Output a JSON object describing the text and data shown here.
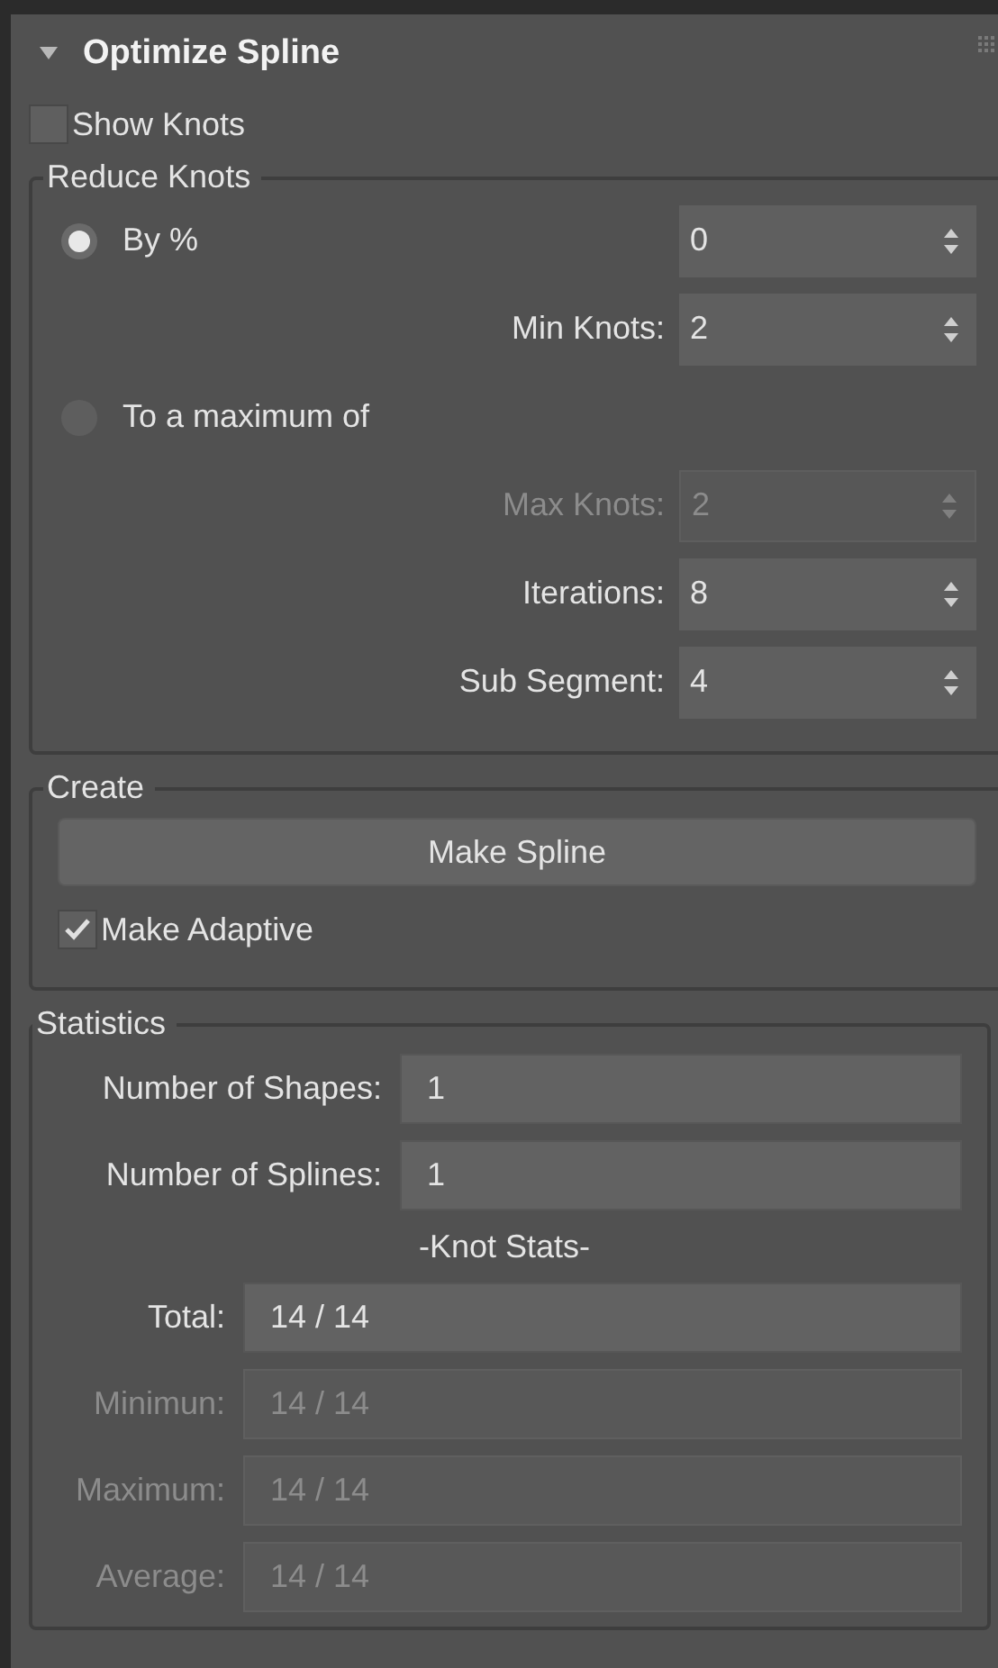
{
  "panel": {
    "title": "Optimize Spline",
    "expanded": true
  },
  "show_knots": {
    "label": "Show Knots",
    "checked": false
  },
  "reduce_knots": {
    "title": "Reduce Knots",
    "rows": [
      {
        "kind": "radio",
        "label": "By %",
        "selected": true,
        "value": "0"
      },
      {
        "kind": "spinner",
        "label": "Min Knots:",
        "value": "2",
        "disabled": false
      },
      {
        "kind": "radio",
        "label": "To a maximum of",
        "selected": false
      },
      {
        "kind": "spinner",
        "label": "Max Knots:",
        "value": "2",
        "disabled": true
      },
      {
        "kind": "spinner",
        "label": "Iterations:",
        "value": "8",
        "disabled": false
      },
      {
        "kind": "spinner",
        "label": "Sub Segment:",
        "value": "4",
        "disabled": false
      }
    ]
  },
  "create": {
    "title": "Create",
    "button": "Make Spline",
    "make_adaptive": {
      "label": "Make Adaptive",
      "checked": true
    }
  },
  "statistics": {
    "title": "Statistics",
    "rows": [
      {
        "label": "Number of Shapes:",
        "value": "1",
        "disabled": false
      },
      {
        "label": "Number of Splines:",
        "value": "1",
        "disabled": false
      }
    ],
    "subheading": "-Knot Stats-",
    "knot_rows": [
      {
        "label": "Total:",
        "value": "14 / 14",
        "disabled": false
      },
      {
        "label": "Minimun:",
        "value": "14 / 14",
        "disabled": true
      },
      {
        "label": "Maximum:",
        "value": "14 / 14",
        "disabled": true
      },
      {
        "label": "Average:",
        "value": "14 / 14",
        "disabled": true
      }
    ]
  }
}
